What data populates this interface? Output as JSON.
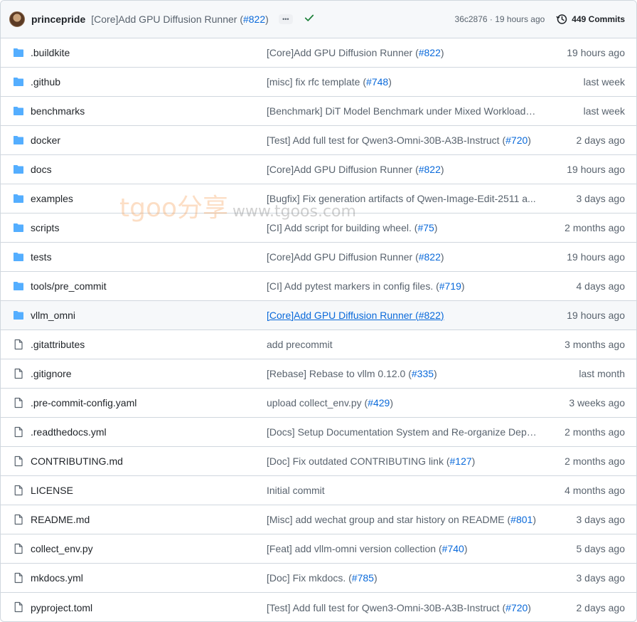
{
  "header": {
    "author": "princepride",
    "commit_message": "[Core]Add GPU Diffusion Runner (",
    "commit_link": "#822",
    "commit_suffix": ")",
    "ellipsis": "•••",
    "status_icon": "check-icon",
    "hash_time": "36c2876 · 19 hours ago",
    "commits_label": "449 Commits"
  },
  "watermark": {
    "brand": "tgoo分享",
    "url": "www.tgoos.com"
  },
  "rows": [
    {
      "type": "folder",
      "name": ".buildkite",
      "msg": "[Core]Add GPU Diffusion Runner (",
      "link": "#822",
      "suffix": ")",
      "time": "19 hours ago"
    },
    {
      "type": "folder",
      "name": ".github",
      "msg": "[misc] fix rfc template (",
      "link": "#748",
      "suffix": ")",
      "time": "last week"
    },
    {
      "type": "folder",
      "name": "benchmarks",
      "msg": "[Benchmark] DiT Model Benchmark under Mixed Workloads ...",
      "link": "",
      "suffix": "",
      "time": "last week"
    },
    {
      "type": "folder",
      "name": "docker",
      "msg": "[Test] Add full test for Qwen3-Omni-30B-A3B-Instruct (",
      "link": "#720",
      "suffix": ")",
      "time": "2 days ago"
    },
    {
      "type": "folder",
      "name": "docs",
      "msg": "[Core]Add GPU Diffusion Runner (",
      "link": "#822",
      "suffix": ")",
      "time": "19 hours ago"
    },
    {
      "type": "folder",
      "name": "examples",
      "msg": "[Bugfix] Fix generation artifacts of Qwen-Image-Edit-2511 a...",
      "link": "",
      "suffix": "",
      "time": "3 days ago"
    },
    {
      "type": "folder",
      "name": "scripts",
      "msg": "[CI] Add script for building wheel. (",
      "link": "#75",
      "suffix": ")",
      "time": "2 months ago"
    },
    {
      "type": "folder",
      "name": "tests",
      "msg": "[Core]Add GPU Diffusion Runner (",
      "link": "#822",
      "suffix": ")",
      "time": "19 hours ago"
    },
    {
      "type": "folder",
      "name": "tools/pre_commit",
      "msg": "[CI] Add pytest markers in config files. (",
      "link": "#719",
      "suffix": ")",
      "time": "4 days ago"
    },
    {
      "type": "folder",
      "name": "vllm_omni",
      "msg": "[Core]Add GPU Diffusion Runner (",
      "link": "#822",
      "suffix": ")",
      "time": "19 hours ago",
      "hover": true
    },
    {
      "type": "file",
      "name": ".gitattributes",
      "msg": "add precommit",
      "link": "",
      "suffix": "",
      "time": "3 months ago"
    },
    {
      "type": "file",
      "name": ".gitignore",
      "msg": "[Rebase] Rebase to vllm 0.12.0 (",
      "link": "#335",
      "suffix": ")",
      "time": "last month"
    },
    {
      "type": "file",
      "name": ".pre-commit-config.yaml",
      "msg": "upload collect_env.py (",
      "link": "#429",
      "suffix": ")",
      "time": "3 weeks ago"
    },
    {
      "type": "file",
      "name": ".readthedocs.yml",
      "msg": "[Docs] Setup Documentation System and Re-organize Depe...",
      "link": "",
      "suffix": "",
      "time": "2 months ago"
    },
    {
      "type": "file",
      "name": "CONTRIBUTING.md",
      "msg": "[Doc] Fix outdated CONTRIBUTING link (",
      "link": "#127",
      "suffix": ")",
      "time": "2 months ago"
    },
    {
      "type": "file",
      "name": "LICENSE",
      "msg": "Initial commit",
      "link": "",
      "suffix": "",
      "time": "4 months ago"
    },
    {
      "type": "file",
      "name": "README.md",
      "msg": "[Misc] add wechat group and star history on README (",
      "link": "#801",
      "suffix": ")",
      "time": "3 days ago"
    },
    {
      "type": "file",
      "name": "collect_env.py",
      "msg": "[Feat] add vllm-omni version collection (",
      "link": "#740",
      "suffix": ")",
      "time": "5 days ago"
    },
    {
      "type": "file",
      "name": "mkdocs.yml",
      "msg": "[Doc] Fix mkdocs. (",
      "link": "#785",
      "suffix": ")",
      "time": "3 days ago"
    },
    {
      "type": "file",
      "name": "pyproject.toml",
      "msg": "[Test] Add full test for Qwen3-Omni-30B-A3B-Instruct (",
      "link": "#720",
      "suffix": ")",
      "time": "2 days ago"
    }
  ]
}
